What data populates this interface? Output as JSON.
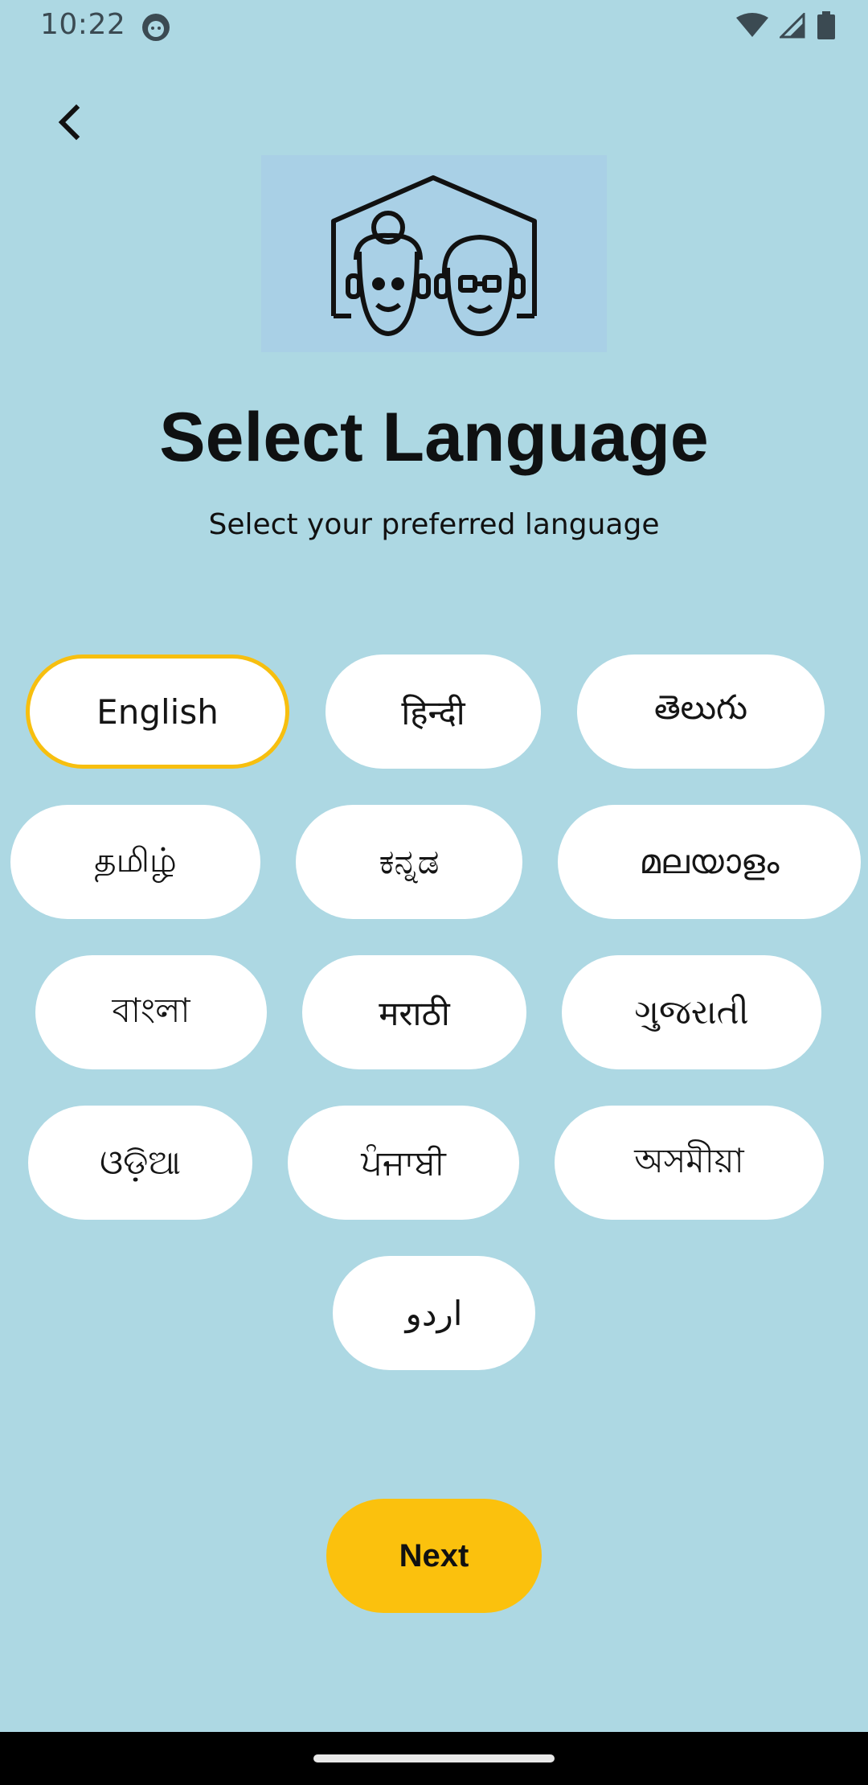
{
  "status_bar": {
    "time": "10:22"
  },
  "header": {
    "back_icon": "chevron-left-icon"
  },
  "logo": {
    "icon": "elderly-couple-house-icon"
  },
  "title": "Select Language",
  "subtitle": "Select your preferred language",
  "languages": [
    {
      "label": "English",
      "selected": true
    },
    {
      "label": "हिन्दी",
      "selected": false
    },
    {
      "label": "తెలుగు",
      "selected": false
    },
    {
      "label": "தமிழ்",
      "selected": false
    },
    {
      "label": "ಕನ್ನಡ",
      "selected": false
    },
    {
      "label": "മലയാളം",
      "selected": false
    },
    {
      "label": "বাংলা",
      "selected": false
    },
    {
      "label": "मराठी",
      "selected": false
    },
    {
      "label": "ગુજરાતી",
      "selected": false
    },
    {
      "label": "ଓଡ଼ିଆ",
      "selected": false
    },
    {
      "label": "ਪੰਜਾਬੀ",
      "selected": false
    },
    {
      "label": "অসমীয়া",
      "selected": false
    },
    {
      "label": "اردو",
      "selected": false
    }
  ],
  "next_button": {
    "label": "Next"
  },
  "colors": {
    "background": "#add8e3",
    "accent": "#fbc10d",
    "selected_border": "#f7bf0f"
  }
}
